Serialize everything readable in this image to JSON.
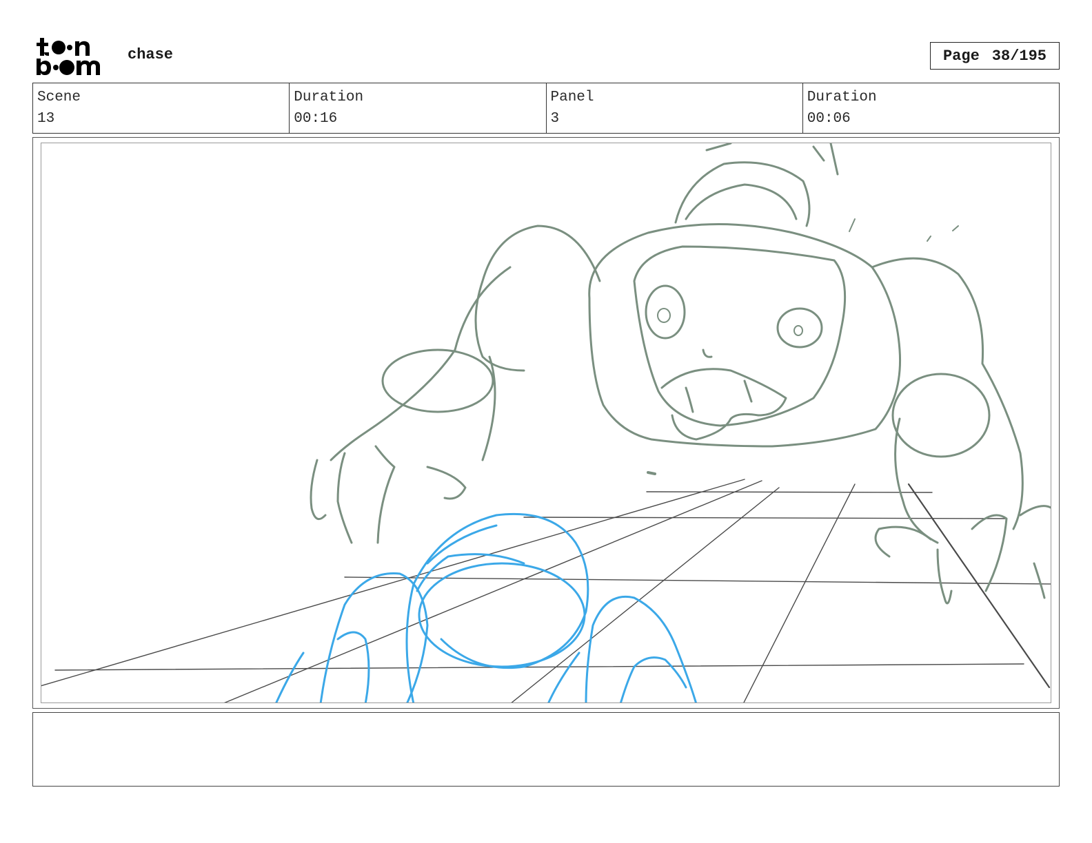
{
  "header": {
    "logo_text": "toon boom",
    "project_title": "chase",
    "page_label": "Page",
    "page_value": "38/195"
  },
  "info": {
    "scene_label": "Scene",
    "scene_value": "13",
    "scene_duration_label": "Duration",
    "scene_duration_value": "00:16",
    "panel_label": "Panel",
    "panel_value": "3",
    "panel_duration_label": "Duration",
    "panel_duration_value": "00:06"
  },
  "panel": {
    "drawing": "storyboard-sketch",
    "colors": {
      "creature_stroke": "#7a8f80",
      "foreground_stroke": "#3ba8e8",
      "grid_stroke": "#4a4a4a"
    }
  },
  "notes": {
    "text": ""
  }
}
